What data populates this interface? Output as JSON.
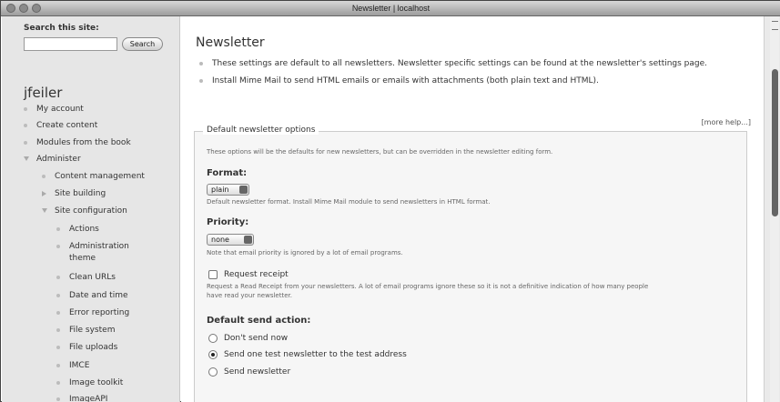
{
  "window": {
    "title": "Newsletter | localhost"
  },
  "sidebar": {
    "search": {
      "label": "Search this site:",
      "value": "",
      "button": "Search"
    },
    "username": "jfeiler",
    "items": [
      {
        "label": "My account"
      },
      {
        "label": "Create content"
      },
      {
        "label": "Modules from the book"
      },
      {
        "label": "Administer"
      },
      {
        "label": "Content management"
      },
      {
        "label": "Site building"
      },
      {
        "label": "Site configuration"
      },
      {
        "label": "Actions"
      },
      {
        "label": "Administration"
      },
      {
        "label": "theme"
      },
      {
        "label": "Clean URLs"
      },
      {
        "label": "Date and time"
      },
      {
        "label": "Error reporting"
      },
      {
        "label": "File system"
      },
      {
        "label": "File uploads"
      },
      {
        "label": "IMCE"
      },
      {
        "label": "Image toolkit"
      },
      {
        "label": "ImageAPI"
      }
    ]
  },
  "main": {
    "title": "Newsletter",
    "notes": [
      "These settings are default to all newsletters. Newsletter specific settings can be found at the newsletter's settings page.",
      "Install Mime Mail to send HTML emails or emails with attachments (both plain text and HTML)."
    ],
    "more_help": "[more help...]",
    "fieldset": {
      "legend": "Default newsletter options",
      "description": "These options will be the defaults for new newsletters, but can be overridden in the newsletter editing form.",
      "format": {
        "label": "Format:",
        "value": "plain",
        "help": "Default newsletter format. Install Mime Mail module to send newsletters in HTML format."
      },
      "priority": {
        "label": "Priority:",
        "value": "none",
        "help": "Note that email priority is ignored by a lot of email programs."
      },
      "receipt": {
        "label": "Request receipt",
        "help1": "Request a Read Receipt from your newsletters. A lot of email programs ignore these so it is not a definitive indication of how many people",
        "help2": "have read your newsletter."
      },
      "send_action": {
        "label": "Default send action:",
        "options": [
          "Don't send now",
          "Send one test newsletter to the test address",
          "Send newsletter"
        ],
        "selected": "Send one test newsletter to the test address"
      }
    }
  }
}
